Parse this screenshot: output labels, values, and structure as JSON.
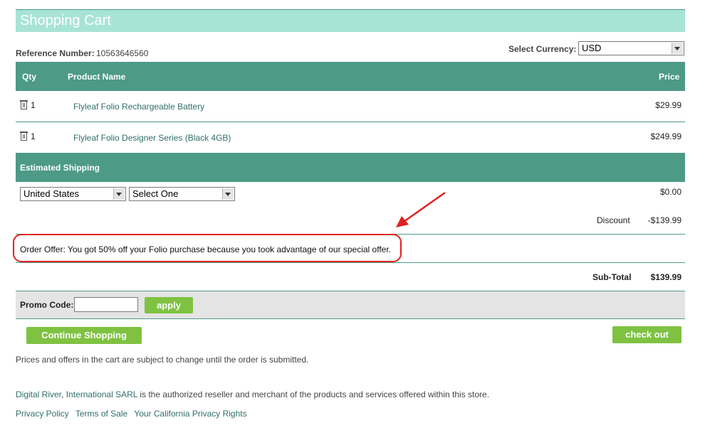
{
  "header": {
    "title": "Shopping Cart"
  },
  "reference": {
    "label": "Reference Number:",
    "value": "10563646560"
  },
  "currency": {
    "label": "Select Currency:",
    "selected": "USD"
  },
  "table": {
    "headers": {
      "qty": "Qty",
      "product": "Product Name",
      "price": "Price"
    },
    "rows": [
      {
        "qty": "1",
        "product": "Flyleaf Folio Rechargeable Battery",
        "price": "$29.99"
      },
      {
        "qty": "1",
        "product": "Flyleaf Folio Designer Series (Black 4GB)",
        "price": "$249.99"
      }
    ]
  },
  "shipping": {
    "heading": "Estimated Shipping",
    "country": "United States",
    "method": "Select One",
    "cost": "$0.00"
  },
  "discount": {
    "label": "Discount",
    "value": "-$139.99"
  },
  "offer": {
    "text": "Order Offer: You got 50% off your Folio purchase because you took advantage of our special offer."
  },
  "subtotal": {
    "label": "Sub-Total",
    "value": "$139.99"
  },
  "promo": {
    "label": "Promo Code:",
    "value": "",
    "apply_label": "apply"
  },
  "actions": {
    "continue_label": "Continue Shopping",
    "checkout_label": "check out"
  },
  "notes": {
    "prices_note": "Prices and offers in the cart are subject to change until the order is submitted.",
    "reseller_link_1": "Digital River",
    "reseller_sep": ", ",
    "reseller_link_2": "International SARL",
    "reseller_text": " is the authorized reseller and merchant of the products and services offered within this store."
  },
  "footer": {
    "links": [
      "Privacy Policy",
      "Terms of Sale",
      "Your California Privacy Rights"
    ]
  },
  "colors": {
    "header_bg": "#a8e3d8",
    "table_head": "#4d9a87",
    "button": "#7fc242",
    "annotation": "#e02020"
  }
}
